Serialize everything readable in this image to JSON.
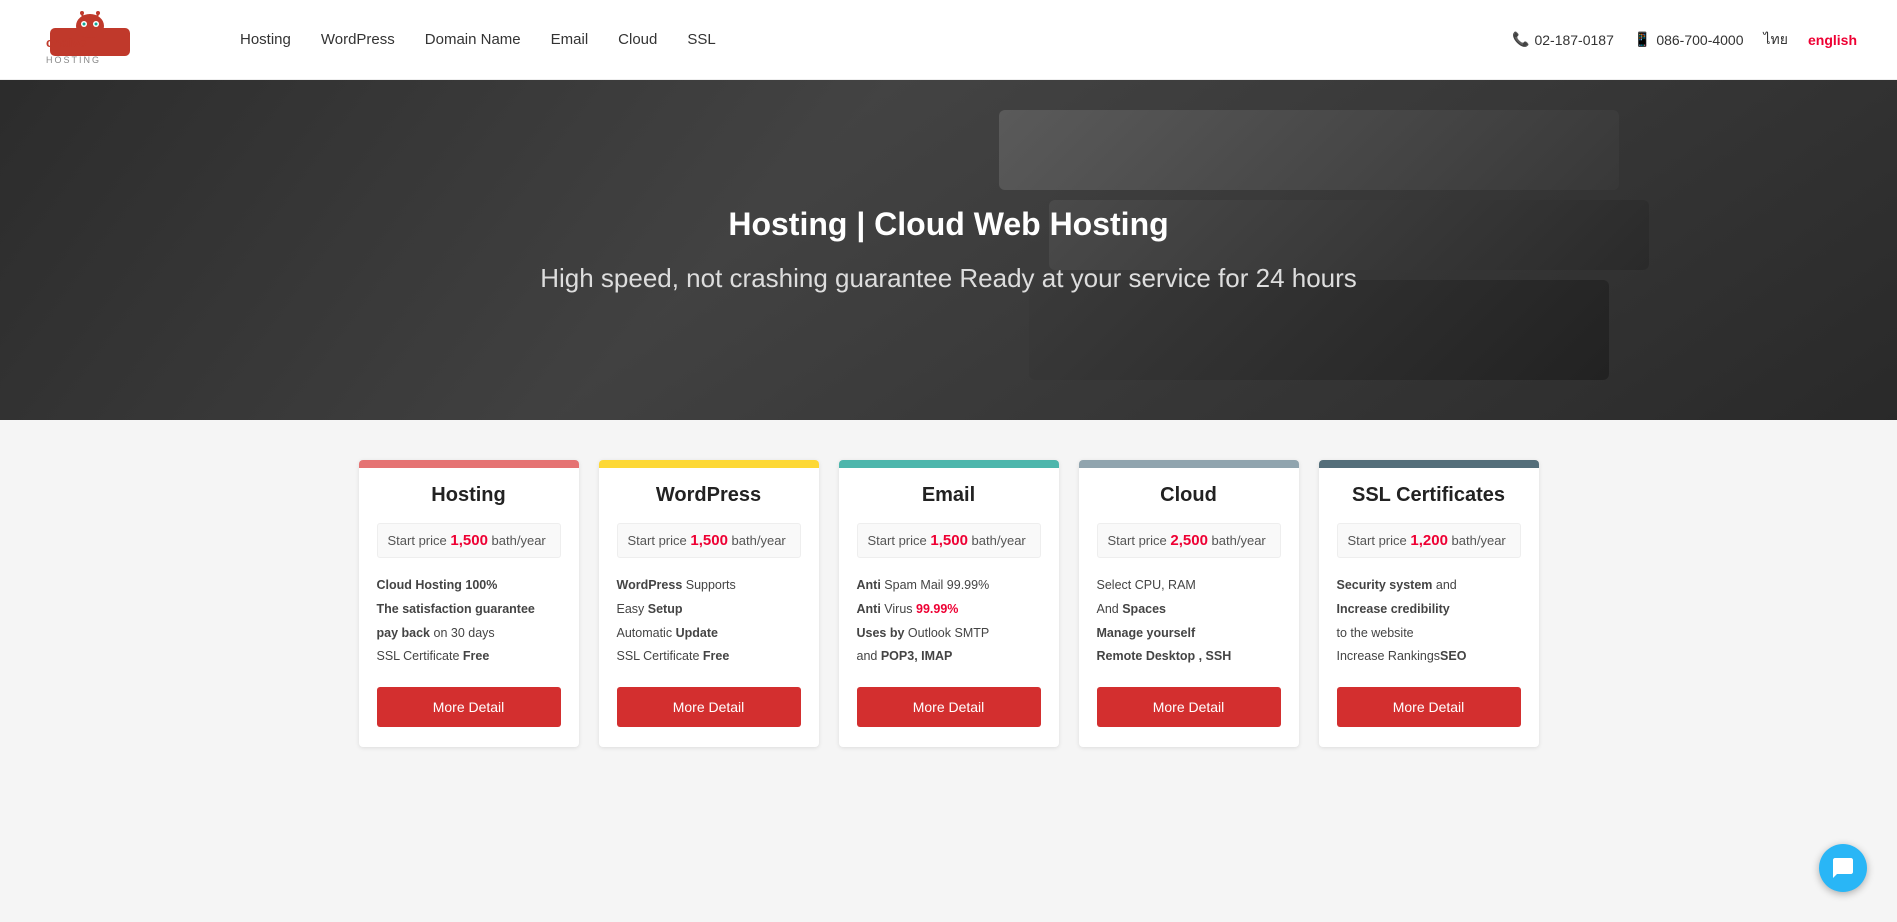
{
  "header": {
    "logo_text": "chaive HOSTING",
    "nav": [
      {
        "label": "Hosting",
        "id": "hosting"
      },
      {
        "label": "WordPress",
        "id": "wordpress"
      },
      {
        "label": "Domain Name",
        "id": "domain"
      },
      {
        "label": "Email",
        "id": "email"
      },
      {
        "label": "Cloud",
        "id": "cloud"
      },
      {
        "label": "SSL",
        "id": "ssl"
      }
    ],
    "phone1": "02-187-0187",
    "phone2": "086-700-4000",
    "lang_th": "ไทย",
    "lang_en": "english"
  },
  "hero": {
    "title": "Hosting | Cloud Web Hosting",
    "subtitle": "High speed, not crashing guarantee Ready at your service for 24 hours"
  },
  "cards": [
    {
      "id": "hosting",
      "title": "Hosting",
      "bar_color": "#e57373",
      "price_label": "Start price",
      "price_num": "1,500",
      "price_unit": "bath/year",
      "features": [
        {
          "text": "Cloud Hosting 100%",
          "bold_part": ""
        },
        {
          "text": "The satisfaction guarantee",
          "bold_part": "The satisfaction guarantee"
        },
        {
          "text": "pay back on 30 days",
          "bold_part": "pay back"
        },
        {
          "text": "SSL Certificate Free",
          "bold_part": "Free"
        }
      ],
      "features_html": "Cloud Hosting 100%<br><b>The satisfaction guarantee</b><br><b>pay back</b> on 30 days<br>SSL Certificate <b>Free</b>",
      "btn_label": "More Detail"
    },
    {
      "id": "wordpress",
      "title": "WordPress",
      "bar_color": "#fdd835",
      "price_label": "Start price",
      "price_num": "1,500",
      "price_unit": "bath/year",
      "features_html": "<b>WordPress</b> Supports<br>Easy <b>Setup</b><br>Automatic <b>Update</b><br>SSL Certificate <b>Free</b>",
      "btn_label": "More Detail"
    },
    {
      "id": "email",
      "title": "Email",
      "bar_color": "#4db6ac",
      "price_label": "Start price",
      "price_num": "1,500",
      "price_unit": "bath/year",
      "features_html": "<b>Anti</b> Spam Mail 99.99%<br><b>Anti</b> Virus <span class='red'>99.99%</span><br><b>Uses by</b> Outlook SMTP<br>and <b>POP3, IMAP</b>",
      "btn_label": "More Detail"
    },
    {
      "id": "cloud",
      "title": "Cloud",
      "bar_color": "#90a4ae",
      "price_label": "Start price",
      "price_num": "2,500",
      "price_unit": "bath/year",
      "features_html": "Select CPU, RAM<br>And <b>Spaces</b><br><b>Manage yourself</b><br><b>Remote Desktop , SSH</b>",
      "btn_label": "More Detail"
    },
    {
      "id": "ssl",
      "title": "SSL Certificates",
      "bar_color": "#546e7a",
      "price_label": "Start price",
      "price_num": "1,200",
      "price_unit": "bath/year",
      "features_html": "<b>Security system</b> and<br><b>Increase credibility</b><br>to the website<br>Increase Rankings<b>SEO</b>",
      "btn_label": "More Detail"
    }
  ]
}
